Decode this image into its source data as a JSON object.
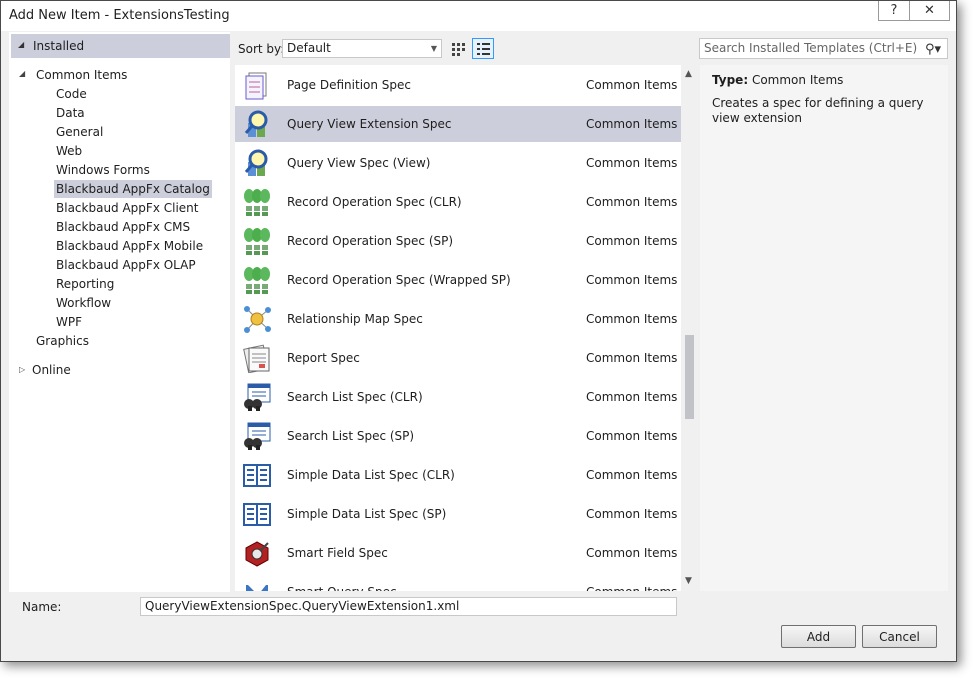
{
  "window": {
    "title": "Add New Item - ExtensionsTesting",
    "help_label": "?",
    "close_label": "✕"
  },
  "tree": {
    "installed": "Installed",
    "common_items": "Common Items",
    "children": [
      "Code",
      "Data",
      "General",
      "Web",
      "Windows Forms",
      "Blackbaud AppFx Catalog",
      "Blackbaud AppFx Client",
      "Blackbaud AppFx CMS",
      "Blackbaud AppFx Mobile",
      "Blackbaud AppFx OLAP",
      "Reporting",
      "Workflow",
      "WPF"
    ],
    "selected": "Blackbaud AppFx Catalog",
    "graphics": "Graphics",
    "online": "Online"
  },
  "toolbar": {
    "sort_label": "Sort by:",
    "sort_value": "Default",
    "search_placeholder": "Search Installed Templates (Ctrl+E)"
  },
  "list": {
    "items": [
      {
        "name": "Page Definition Spec",
        "category": "Common Items",
        "icon": "page-definition-icon"
      },
      {
        "name": "Query View Extension Spec",
        "category": "Common Items",
        "icon": "query-magnifier-icon",
        "selected": true
      },
      {
        "name": "Query View Spec (View)",
        "category": "Common Items",
        "icon": "query-magnifier-icon"
      },
      {
        "name": "Record Operation Spec (CLR)",
        "category": "Common Items",
        "icon": "record-operation-icon"
      },
      {
        "name": "Record Operation Spec (SP)",
        "category": "Common Items",
        "icon": "record-operation-icon"
      },
      {
        "name": "Record Operation Spec (Wrapped SP)",
        "category": "Common Items",
        "icon": "record-operation-icon"
      },
      {
        "name": "Relationship Map Spec",
        "category": "Common Items",
        "icon": "relationship-map-icon"
      },
      {
        "name": "Report Spec",
        "category": "Common Items",
        "icon": "report-icon"
      },
      {
        "name": "Search List Spec (CLR)",
        "category": "Common Items",
        "icon": "search-list-icon"
      },
      {
        "name": "Search List Spec (SP)",
        "category": "Common Items",
        "icon": "search-list-icon"
      },
      {
        "name": "Simple Data List Spec (CLR)",
        "category": "Common Items",
        "icon": "simple-data-list-icon"
      },
      {
        "name": "Simple Data List Spec (SP)",
        "category": "Common Items",
        "icon": "simple-data-list-icon"
      },
      {
        "name": "Smart Field Spec",
        "category": "Common Items",
        "icon": "smart-field-icon"
      },
      {
        "name": "Smart Query Spec",
        "category": "Common Items",
        "icon": "smart-query-icon"
      }
    ]
  },
  "details": {
    "type_label": "Type:",
    "type_value": "Common Items",
    "description": "Creates a spec for defining a query view extension"
  },
  "footer": {
    "name_label": "Name:",
    "name_value": "QueryViewExtensionSpec.QueryViewExtension1.xml",
    "add_label": "Add",
    "cancel_label": "Cancel"
  },
  "colors": {
    "selection": "#cccedb",
    "accent": "#3399ff"
  }
}
